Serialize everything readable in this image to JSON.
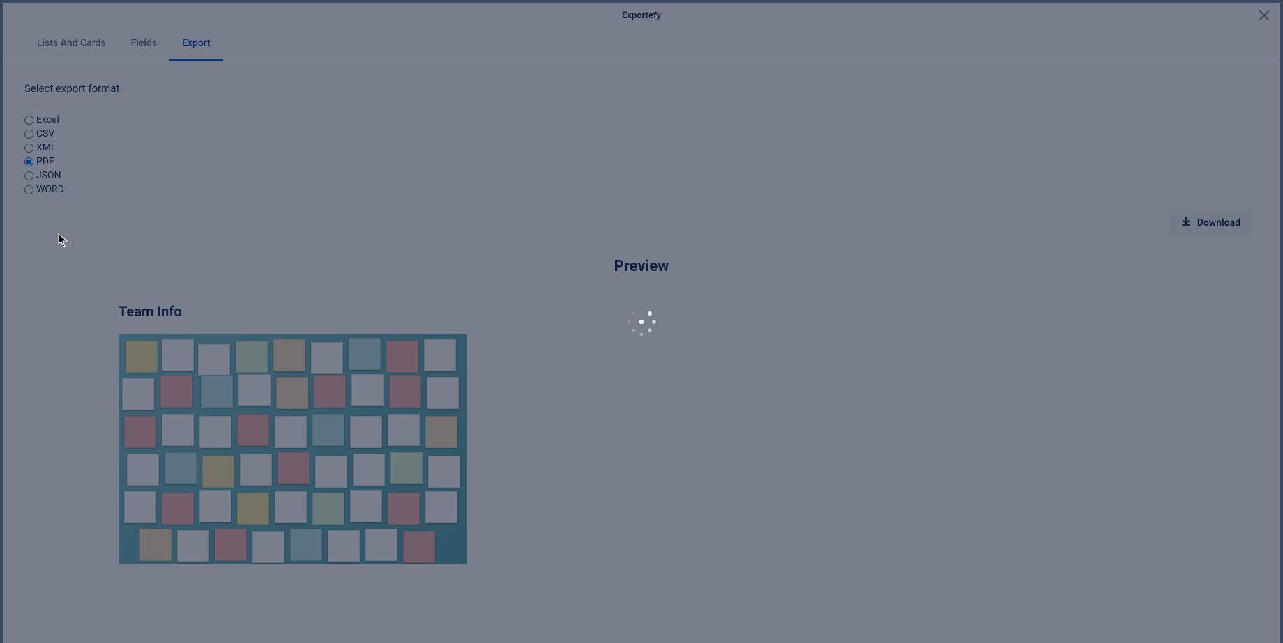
{
  "header": {
    "title": "Exportefy"
  },
  "tabs": {
    "lists": "Lists And Cards",
    "fields": "Fields",
    "export": "Export"
  },
  "export": {
    "prompt": "Select export format.",
    "options": {
      "excel": "Excel",
      "csv": "CSV",
      "xml": "XML",
      "pdf": "PDF",
      "json": "JSON",
      "word": "WORD"
    },
    "selected": "pdf",
    "download_label": "Download"
  },
  "preview": {
    "heading": "Preview",
    "page_title": "Team Info"
  },
  "icons": {
    "close": "close-icon",
    "download": "download-icon"
  }
}
